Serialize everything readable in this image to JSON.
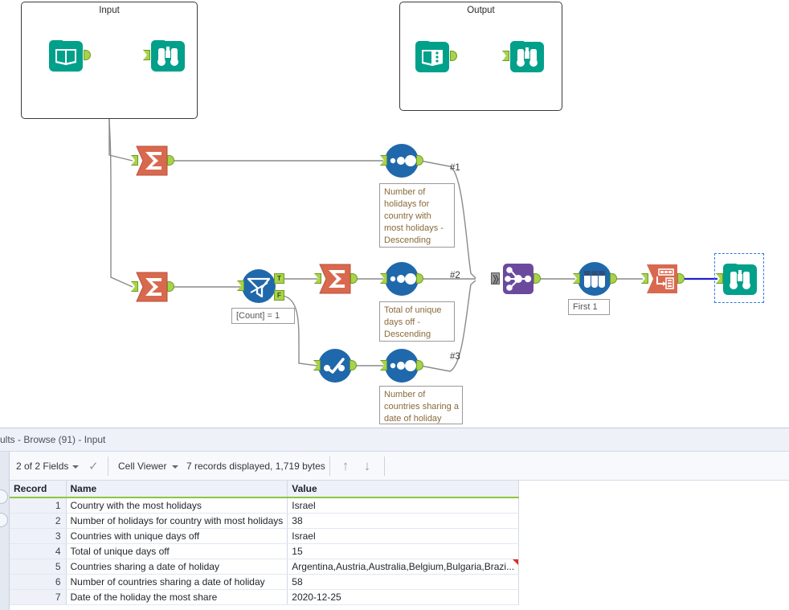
{
  "canvas": {
    "containers": [
      {
        "name": "input-container",
        "title": "Input"
      },
      {
        "name": "output-container",
        "title": "Output"
      }
    ],
    "connection_labels": [
      "#1",
      "#2",
      "#3"
    ],
    "annotations": [
      {
        "id": "annot-sort-1",
        "text": "Number of holidays for country with most holidays - Descending"
      },
      {
        "id": "annot-filter",
        "text": "[Count] = 1"
      },
      {
        "id": "annot-sort-2",
        "text": "Total of unique days off - Descending"
      },
      {
        "id": "annot-sort-3",
        "text": "Number of countries sharing a date of holiday"
      },
      {
        "id": "annot-sample",
        "text": "First 1"
      }
    ],
    "filter_anchors": {
      "true": "T",
      "false": "F"
    },
    "tools": [
      {
        "id": "input-data-1",
        "label": "Input Data",
        "icon": "book-icon"
      },
      {
        "id": "browse-input",
        "label": "Browse",
        "icon": "binoculars-icon"
      },
      {
        "id": "text-input-1",
        "label": "Text Input",
        "icon": "book-dots-icon"
      },
      {
        "id": "browse-output",
        "label": "Browse",
        "icon": "binoculars-icon"
      },
      {
        "id": "summarize-1",
        "label": "Summarize",
        "icon": "sigma-icon"
      },
      {
        "id": "summarize-2",
        "label": "Summarize",
        "icon": "sigma-icon"
      },
      {
        "id": "summarize-3",
        "label": "Summarize",
        "icon": "sigma-icon"
      },
      {
        "id": "filter-1",
        "label": "Filter",
        "icon": "funnel-icon"
      },
      {
        "id": "unique-1",
        "label": "Unique",
        "icon": "unique-icon"
      },
      {
        "id": "sort-1",
        "label": "Sort",
        "icon": "sort-dots-icon"
      },
      {
        "id": "sort-2",
        "label": "Sort",
        "icon": "sort-dots-icon"
      },
      {
        "id": "sort-3",
        "label": "Sort",
        "icon": "sort-dots-icon"
      },
      {
        "id": "union-1",
        "label": "Union",
        "icon": "union-node-icon"
      },
      {
        "id": "sample-1",
        "label": "Sample",
        "icon": "test-tubes-icon"
      },
      {
        "id": "transpose-1",
        "label": "Transpose",
        "icon": "transpose-icon"
      },
      {
        "id": "browse-final",
        "label": "Browse",
        "icon": "binoculars-icon",
        "selected": true
      }
    ]
  },
  "results": {
    "title": "ults - Browse (91) - Input",
    "toolbar": {
      "fields_label": "2 of 2 Fields",
      "viewer_label": "Cell Viewer",
      "records_label": "7 records displayed, 1,719 bytes",
      "up_arrow": "↑",
      "down_arrow": "↓",
      "check_glyph": "✓"
    },
    "grid": {
      "columns": [
        "Record",
        "Name",
        "Value"
      ],
      "rows": [
        {
          "record": "1",
          "name": "Country with the most holidays",
          "value": "Israel",
          "truncated": false
        },
        {
          "record": "2",
          "name": "Number of holidays for country with most holidays",
          "value": "38",
          "truncated": false
        },
        {
          "record": "3",
          "name": "Countries with unique days off",
          "value": "Israel",
          "truncated": false
        },
        {
          "record": "4",
          "name": "Total of unique days off",
          "value": "15",
          "truncated": false
        },
        {
          "record": "5",
          "name": "Countries sharing a date of holiday",
          "value": "Argentina,Austria,Australia,Belgium,Bulgaria,Brazi...",
          "truncated": true
        },
        {
          "record": "6",
          "name": "Number of countries sharing a date of holiday",
          "value": "58",
          "truncated": false
        },
        {
          "record": "7",
          "name": "Date of the holiday the most share",
          "value": "2020-12-25",
          "truncated": false
        }
      ]
    }
  },
  "colors": {
    "teal": "#00a08b",
    "orange": "#d9694e",
    "blue": "#1f68ab",
    "purple": "#6b4a9e",
    "anchor_green": "#a8d24b",
    "header_green": "#8ec63f",
    "selection_blue": "#2a7ae2"
  }
}
